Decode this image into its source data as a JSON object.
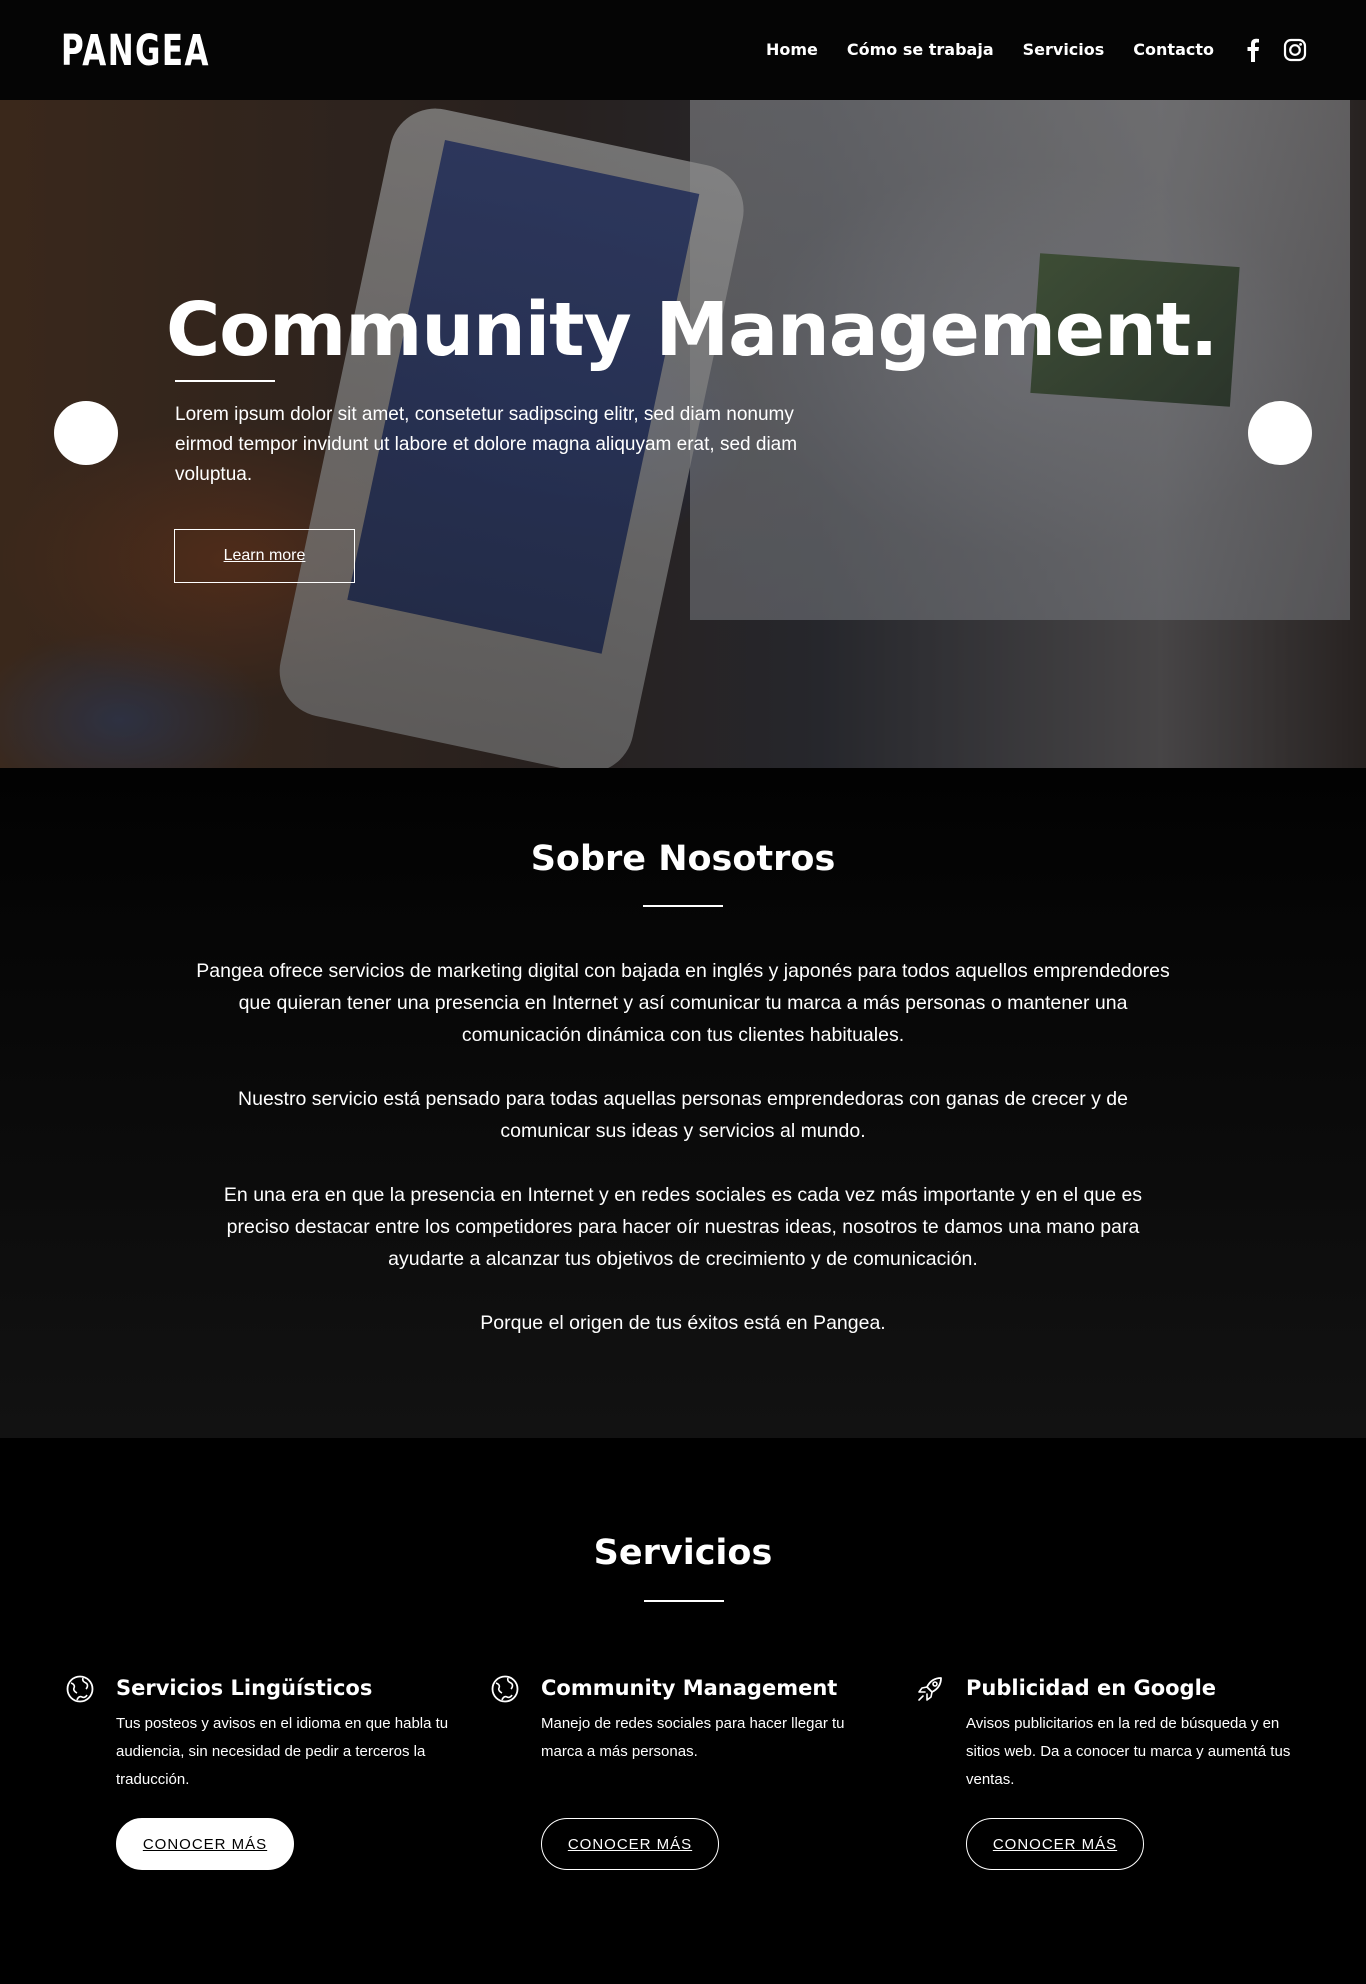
{
  "header": {
    "logo": "PANGEA",
    "nav": [
      "Home",
      "Cómo se trabaja",
      "Servicios",
      "Contacto"
    ],
    "social_icons": [
      "facebook-icon",
      "instagram-icon"
    ]
  },
  "hero": {
    "title": "Community Management.",
    "text": "Lorem ipsum dolor sit amet, consetetur sadipscing elitr, sed diam nonumy eirmod tempor invidunt ut labore et dolore magna aliquyam erat, sed diam voluptua.",
    "button": "Learn more"
  },
  "about": {
    "title": "Sobre Nosotros",
    "paragraphs": [
      "Pangea ofrece servicios de marketing digital con bajada en inglés y japonés para todos aquellos emprendedores que quieran tener una presencia en Internet y así comunicar tu marca a más personas o mantener una comunicación dinámica con tus clientes habituales.",
      "Nuestro servicio está pensado para todas aquellas personas emprendedoras con ganas de crecer y de comunicar sus ideas y servicios al mundo.",
      "En una era en que la presencia en Internet y en redes sociales es cada vez más importante y en el que es preciso destacar entre los competidores para hacer oír nuestras ideas, nosotros te damos una mano para ayudarte a alcanzar tus objetivos de crecimiento y de comunicación.",
      "Porque el origen de tus éxitos está en Pangea."
    ]
  },
  "services": {
    "title": "Servicios",
    "items": [
      {
        "icon": "globe-icon",
        "name": "Servicios Lingüísticos",
        "desc": "Tus posteos y avisos en el idioma en que habla tu audiencia, sin necesidad de pedir a terceros la traducción.",
        "button": "CONOCER MÁS"
      },
      {
        "icon": "globe-icon",
        "name": "Community Management",
        "desc": "Manejo de redes sociales para hacer llegar tu marca a más personas.",
        "button": "CONOCER MÁS"
      },
      {
        "icon": "rocket-icon",
        "name": "Publicidad en Google",
        "desc": "Avisos publicitarios en la red de búsqueda y en sitios web. Da a conocer tu marca y aumentá tus ventas.",
        "button": "CONOCER MÁS"
      }
    ]
  }
}
